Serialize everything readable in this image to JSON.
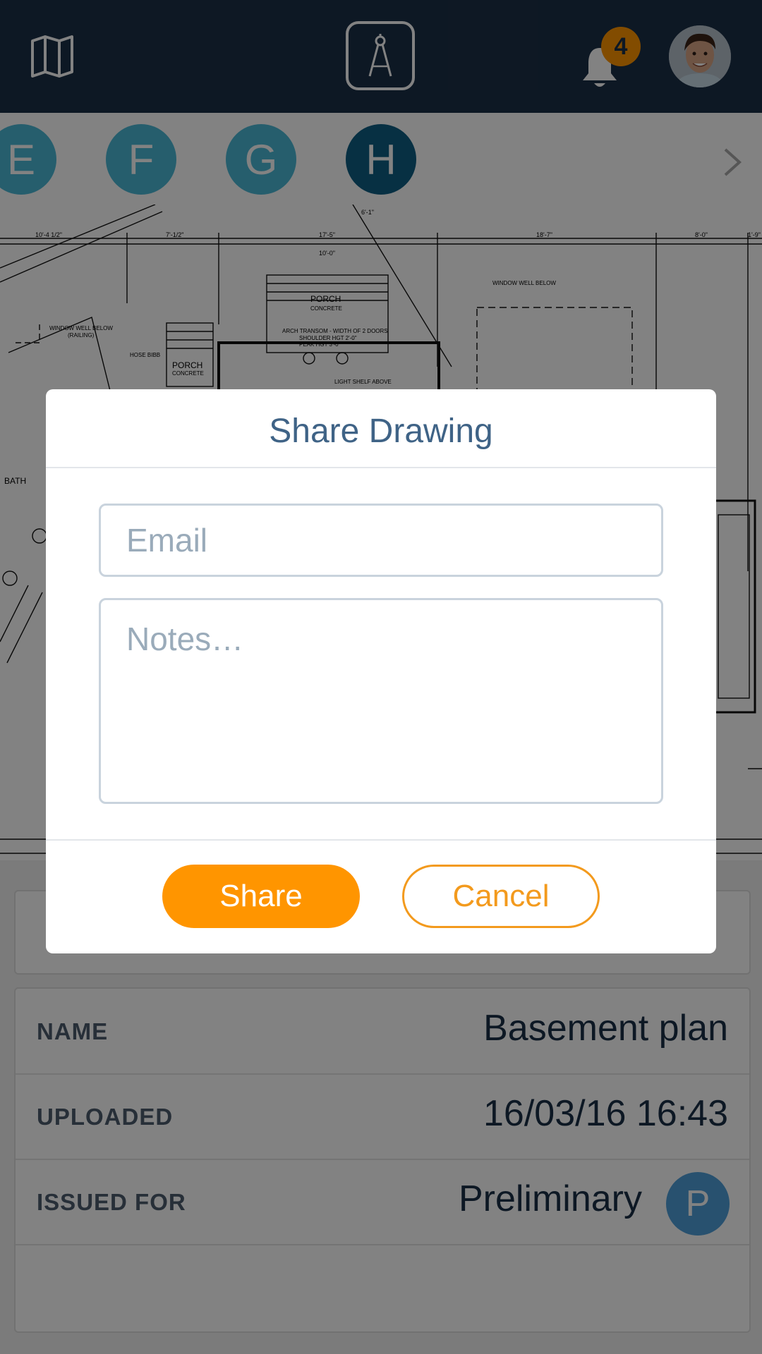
{
  "header": {
    "map_icon": "map-icon",
    "logo_icon": "drafting-compass-icon",
    "notification_icon": "bell-icon",
    "notification_count": "4",
    "avatar": "user-avatar"
  },
  "letters": {
    "items": [
      {
        "label": "E",
        "active": false
      },
      {
        "label": "F",
        "active": false
      },
      {
        "label": "G",
        "active": false
      },
      {
        "label": "H",
        "active": true
      }
    ],
    "next_icon": "chevron-right-icon"
  },
  "drawing": {
    "labels": {
      "porch1": "PORCH",
      "porch1_sub": "CONCRETE",
      "porch2": "PORCH",
      "porch2_sub": "CONCRETE",
      "window_well_1": "WINDOW WELL BELOW",
      "window_well_2": "WINDOW WELL BELOW",
      "window_well_2_sub": "(RAILING)",
      "arch_transom": "ARCH TRANSOM - WIDTH OF 2 DOORS",
      "shoulder": "SHOULDER HGT 2'-0\"",
      "peak": "PEAK HGT 3'-0\"",
      "hose_bibb": "HOSE BIBB",
      "light_shelf": "LIGHT SHELF ABOVE",
      "bath": "BATH",
      "dim_top": "6'-1\"",
      "dim_a": "10'-4 1/2\"",
      "dim_b": "7'-1/2\"",
      "dim_c": "17'-5\"",
      "dim_d": "10'-0\"",
      "dim_e": "18'-7\"",
      "dim_f": "8'-0\"",
      "dim_g": "1'-9\""
    }
  },
  "details": {
    "rows": [
      {
        "label": "NAME",
        "value": "Basement plan"
      },
      {
        "label": "UPLOADED",
        "value": "16/03/16 16:43"
      },
      {
        "label": "ISSUED FOR",
        "value": "Preliminary",
        "badge": "P"
      }
    ]
  },
  "modal": {
    "title": "Share Drawing",
    "email_placeholder": "Email",
    "notes_placeholder": "Notes…",
    "share_label": "Share",
    "cancel_label": "Cancel"
  },
  "colors": {
    "header_bg": "#1b2f47",
    "accent_orange": "#ff9500",
    "letter_blue": "#4cb8d6",
    "letter_active": "#0f5e84",
    "modal_title": "#3f6386"
  }
}
